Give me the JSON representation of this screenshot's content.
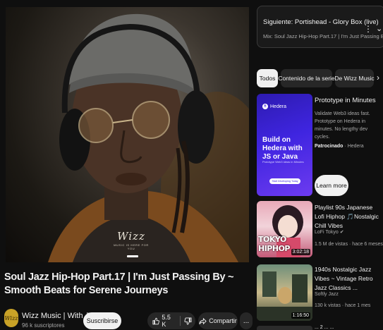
{
  "player": {
    "watermark_logo": "Wizz",
    "watermark_sub": "MUSIC IS HERE FOR YOU"
  },
  "video": {
    "title": "Soul Jazz Hip-Hop Part.17 | I'm Just Passing By ~ Smooth Beats for Serene Journeys",
    "channel": "Wizz Music | With Jazz",
    "subscribers": "96 k suscriptores",
    "avatar_text": "Wizz",
    "subscribe_label": "Suscribirse",
    "likes": "5.5 K",
    "share_label": "Compartir",
    "more_label": "..."
  },
  "up_next": {
    "title": "Siguiente: Portishead - Glory Box (live)",
    "subtitle": "Mix: Soul Jazz Hip-Hop Part.17 | I'm Just Passing By ..."
  },
  "chips": [
    "Todos",
    "Contenido de la serie",
    "De Wizz Music"
  ],
  "ad": {
    "brand": "Hedera",
    "headline": "Build on Hedera with JS or Java",
    "small_text": "Prototype Web3 ideas in Minutes",
    "cta_small": "Start Developing Today",
    "title": "Prototype in Minutes",
    "description": "Validate Web3 ideas fast. Prototype on Hedera in minutes. No lengthy dev cycles.",
    "sponsor_label": "Patrocinado",
    "sponsor_name": "Hedera",
    "button_label": "Learn more"
  },
  "recommended": [
    {
      "title": "Playlist 90s Japanese Lofi Hiphop 🎵Nostalgic Chill Vibes",
      "channel": "LoFi Tokyo",
      "meta": "1.5 M de vistas · hace 6 meses",
      "duration": "3:02:18",
      "thumb_text": "TOKYO HIPHOP"
    },
    {
      "title": "1940s Nostalgic Jazz Vibes ~ Vintage Retro Jazz Classics ...",
      "channel": "Softly Jazz",
      "meta": "130 k vistas · hace 1 mes",
      "duration": "1:16:50"
    }
  ],
  "peek": {
    "title": "... 2 ... ..."
  },
  "colors": {
    "background": "#0f0f0f",
    "chip_active": "#f1f1f1",
    "chip": "#272727",
    "ad_accent": "#3f25e0"
  }
}
